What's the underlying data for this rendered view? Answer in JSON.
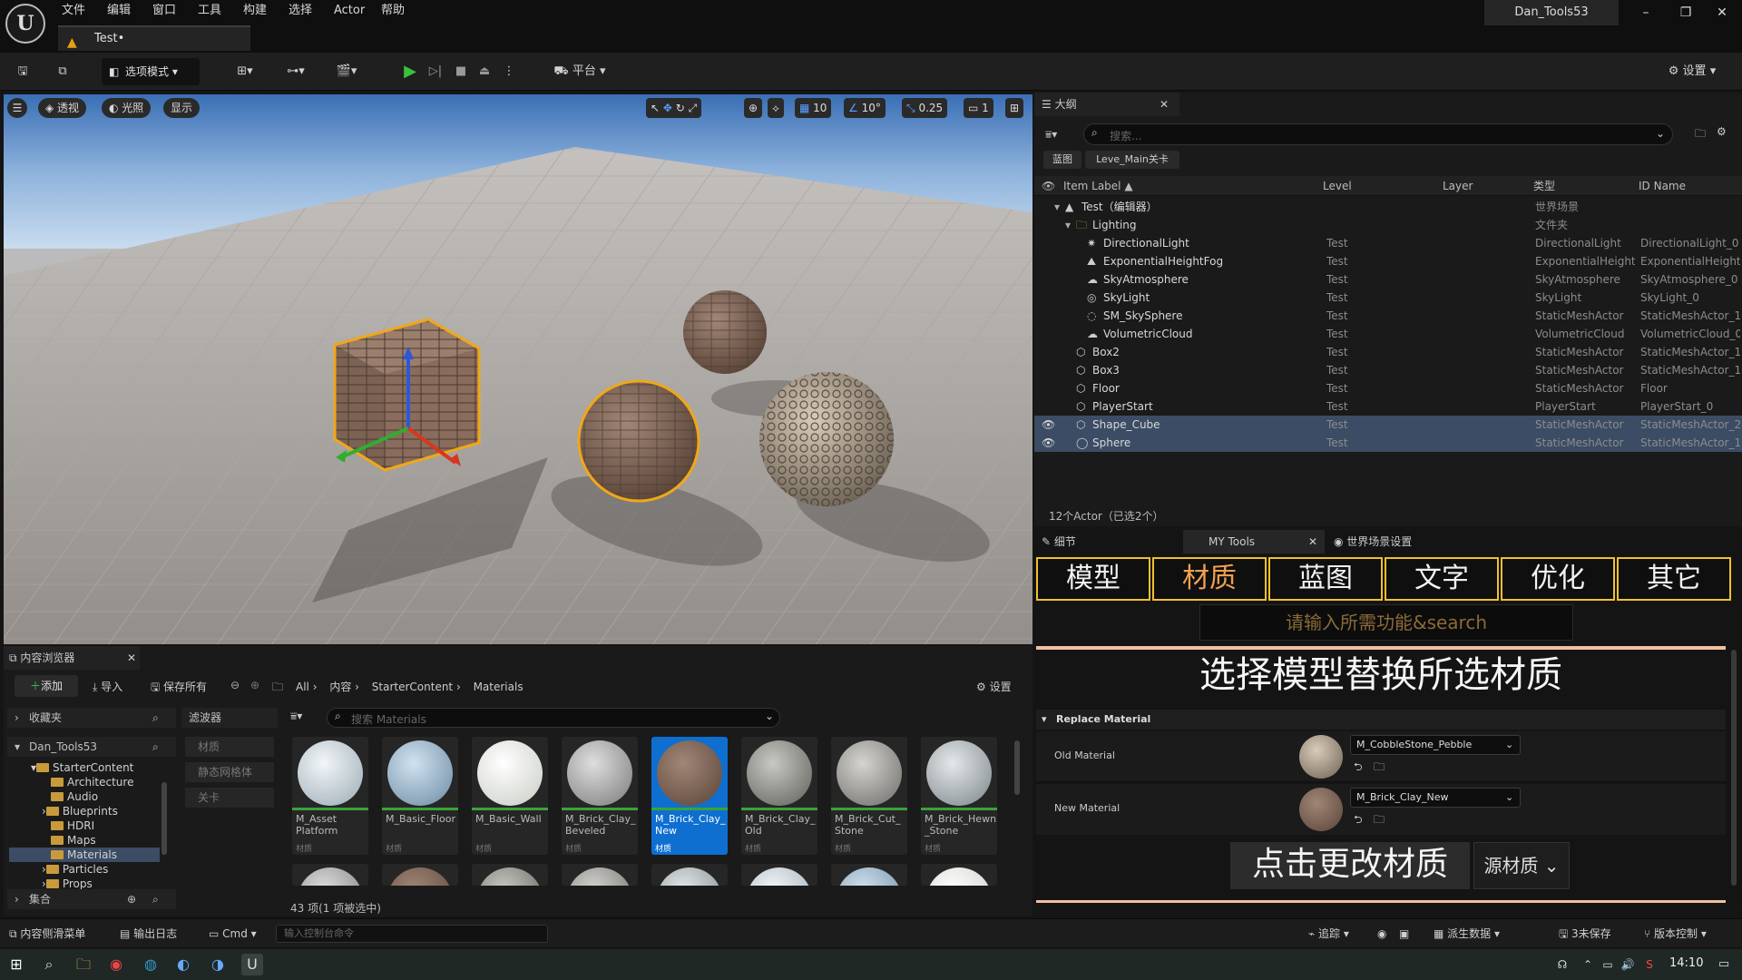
{
  "menu": {
    "items": [
      "文件",
      "编辑",
      "窗口",
      "工具",
      "构建",
      "选择",
      "Actor",
      "帮助"
    ],
    "tab": "Test•",
    "window_title": "Dan_Tools53"
  },
  "toolbar": {
    "mode": "选项模式",
    "platform": "平台",
    "settings": "设置"
  },
  "viewport": {
    "perspective": "透视",
    "lighting": "光照",
    "show": "显示",
    "grid": "10",
    "angle": "10°",
    "scale": "0.25",
    "camera": "1"
  },
  "outliner": {
    "title": "大纲",
    "search_placeholder": "搜索...",
    "filter_tabs": [
      "蓝图",
      "Leve_Main关卡"
    ],
    "columns": [
      "Item Label ▲",
      "Level",
      "Layer",
      "类型",
      "ID Name"
    ],
    "rows": [
      {
        "label": "Test（编辑器）",
        "level": "",
        "type": "世界场景",
        "id": ""
      },
      {
        "label": "Lighting",
        "level": "",
        "type": "文件夹",
        "id": ""
      },
      {
        "label": "DirectionalLight",
        "level": "Test",
        "type": "DirectionalLight",
        "id": "DirectionalLight_0"
      },
      {
        "label": "ExponentialHeightFog",
        "level": "Test",
        "type": "ExponentialHeightF",
        "id": "ExponentialHeightF"
      },
      {
        "label": "SkyAtmosphere",
        "level": "Test",
        "type": "SkyAtmosphere",
        "id": "SkyAtmosphere_0"
      },
      {
        "label": "SkyLight",
        "level": "Test",
        "type": "SkyLight",
        "id": "SkyLight_0"
      },
      {
        "label": "SM_SkySphere",
        "level": "Test",
        "type": "StaticMeshActor",
        "id": "StaticMeshActor_1"
      },
      {
        "label": "VolumetricCloud",
        "level": "Test",
        "type": "VolumetricCloud",
        "id": "VolumetricCloud_0"
      },
      {
        "label": "Box2",
        "level": "Test",
        "type": "StaticMeshActor",
        "id": "StaticMeshActor_1"
      },
      {
        "label": "Box3",
        "level": "Test",
        "type": "StaticMeshActor",
        "id": "StaticMeshActor_1"
      },
      {
        "label": "Floor",
        "level": "Test",
        "type": "StaticMeshActor",
        "id": "Floor"
      },
      {
        "label": "PlayerStart",
        "level": "Test",
        "type": "PlayerStart",
        "id": "PlayerStart_0"
      },
      {
        "label": "Shape_Cube",
        "level": "Test",
        "type": "StaticMeshActor",
        "id": "StaticMeshActor_2"
      },
      {
        "label": "Sphere",
        "level": "Test",
        "type": "StaticMeshActor",
        "id": "StaticMeshActor_1"
      }
    ],
    "count": "12个Actor（已选2个）"
  },
  "tools": {
    "tab_details": "细节",
    "tab_mytools": "MY Tools",
    "tab_world": "世界场景设置",
    "categories": [
      "模型",
      "材质",
      "蓝图",
      "文字",
      "优化",
      "其它"
    ],
    "search_placeholder": "请输入所需功能&search",
    "headline": "选择模型替换所选材质",
    "section": "Replace Material",
    "old_label": "Old Material",
    "old_value": "M_CobbleStone_Pebble",
    "new_label": "New Material",
    "new_value": "M_Brick_Clay_New",
    "apply": "点击更改材质",
    "source": "源材质"
  },
  "content": {
    "title": "内容浏览器",
    "add": "添加",
    "import": "导入",
    "save_all": "保存所有",
    "path": [
      "All",
      "内容",
      "StarterContent",
      "Materials"
    ],
    "settings": "设置",
    "favorites": "收藏夹",
    "project": "Dan_Tools53",
    "tree": [
      "StarterContent",
      "Architecture",
      "Audio",
      "Blueprints",
      "HDRI",
      "Maps",
      "Materials",
      "Particles",
      "Props"
    ],
    "collections": "集合",
    "filters_title": "滤波器",
    "filters": [
      "材质",
      "静态网格体",
      "关卡"
    ],
    "search_placeholder": "搜索 Materials",
    "assets": [
      {
        "name": "M_Asset Platform",
        "type": "材质"
      },
      {
        "name": "M_Basic_Floor",
        "type": "材质"
      },
      {
        "name": "M_Basic_Wall",
        "type": "材质"
      },
      {
        "name": "M_Brick_Clay_ Beveled",
        "type": "材质"
      },
      {
        "name": "M_Brick_Clay_ New",
        "type": "材质"
      },
      {
        "name": "M_Brick_Clay_ Old",
        "type": "材质"
      },
      {
        "name": "M_Brick_Cut_ Stone",
        "type": "材质"
      },
      {
        "name": "M_Brick_Hewn _Stone",
        "type": "材质"
      }
    ],
    "count": "43 项(1 项被选中)"
  },
  "status": {
    "drawer": "内容侧滑菜单",
    "log": "输出日志",
    "cmd": "Cmd",
    "cmd_placeholder": "输入控制台命令",
    "trace": "追踪",
    "derived": "派生数据",
    "unsaved": "3未保存",
    "vcs": "版本控制"
  },
  "taskbar": {
    "time": "14:10"
  }
}
